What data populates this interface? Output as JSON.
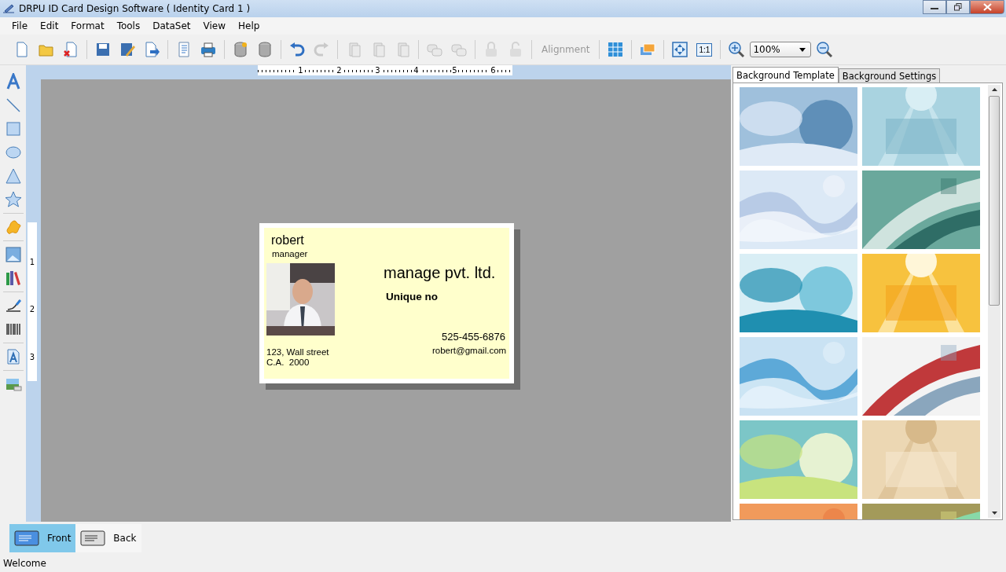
{
  "window": {
    "title": "DRPU ID Card Design Software ( Identity Card 1 )"
  },
  "menu": [
    {
      "label": "File"
    },
    {
      "label": "Edit"
    },
    {
      "label": "Format"
    },
    {
      "label": "Tools"
    },
    {
      "label": "DataSet"
    },
    {
      "label": "View"
    },
    {
      "label": "Help"
    }
  ],
  "toolbar": [
    {
      "kind": "button",
      "disabled": false
    },
    {
      "kind": "button",
      "disabled": false
    },
    {
      "kind": "button",
      "disabled": false
    },
    {
      "kind": "separator"
    },
    {
      "kind": "button",
      "disabled": false
    },
    {
      "kind": "button",
      "disabled": false
    },
    {
      "kind": "button",
      "disabled": false
    },
    {
      "kind": "separator"
    },
    {
      "kind": "button",
      "disabled": false
    },
    {
      "kind": "button",
      "disabled": false
    },
    {
      "kind": "separator"
    },
    {
      "kind": "button",
      "disabled": false
    },
    {
      "kind": "button",
      "disabled": false
    },
    {
      "kind": "separator"
    },
    {
      "kind": "button",
      "disabled": false
    },
    {
      "kind": "button",
      "disabled": true
    },
    {
      "kind": "separator"
    },
    {
      "kind": "button",
      "disabled": true
    },
    {
      "kind": "button",
      "disabled": true
    },
    {
      "kind": "button",
      "disabled": true
    },
    {
      "kind": "separator"
    },
    {
      "kind": "button",
      "disabled": true
    },
    {
      "kind": "button",
      "disabled": true
    },
    {
      "kind": "separator"
    },
    {
      "kind": "button",
      "disabled": true
    },
    {
      "kind": "button",
      "disabled": true
    },
    {
      "kind": "separator"
    },
    {
      "kind": "dropdown",
      "label": "Alignment",
      "disabled": true
    },
    {
      "kind": "separator"
    },
    {
      "kind": "button",
      "disabled": false
    },
    {
      "kind": "separator"
    },
    {
      "kind": "button",
      "disabled": false
    },
    {
      "kind": "separator"
    },
    {
      "kind": "button",
      "disabled": false
    },
    {
      "kind": "text-button",
      "label": "1:1",
      "disabled": false
    },
    {
      "kind": "separator"
    },
    {
      "kind": "button",
      "disabled": false
    },
    {
      "kind": "combo",
      "value": "100%"
    },
    {
      "kind": "button",
      "disabled": false
    }
  ],
  "rulers": {
    "horizontal": [
      "1",
      "2",
      "3",
      "4",
      "5",
      "6"
    ],
    "vertical": [
      "1",
      "2",
      "3"
    ]
  },
  "card": {
    "name": "robert",
    "designation": "manager",
    "photo": {
      "kind": "picture"
    },
    "company": "manage pvt. ltd.",
    "unique_no": "Unique no",
    "phone": "525-455-6876",
    "email": "robert@gmail.com",
    "address": [
      "123, Wall street",
      "C.A.  2000"
    ]
  },
  "panel": {
    "tabs": [
      {
        "label": "Background Template",
        "selected": true
      },
      {
        "label": "Background Settings",
        "selected": false
      }
    ],
    "templates": [
      {
        "kind": "picture"
      },
      {
        "kind": "picture"
      },
      {
        "kind": "picture"
      },
      {
        "kind": "picture"
      },
      {
        "kind": "picture"
      },
      {
        "kind": "picture"
      },
      {
        "kind": "picture"
      },
      {
        "kind": "picture"
      },
      {
        "kind": "picture"
      },
      {
        "kind": "picture"
      },
      {
        "kind": "picture"
      },
      {
        "kind": "picture"
      }
    ]
  },
  "sides": [
    {
      "label": "Front",
      "selected": true
    },
    {
      "label": "Back",
      "selected": false
    }
  ],
  "status_bar": "Welcome"
}
